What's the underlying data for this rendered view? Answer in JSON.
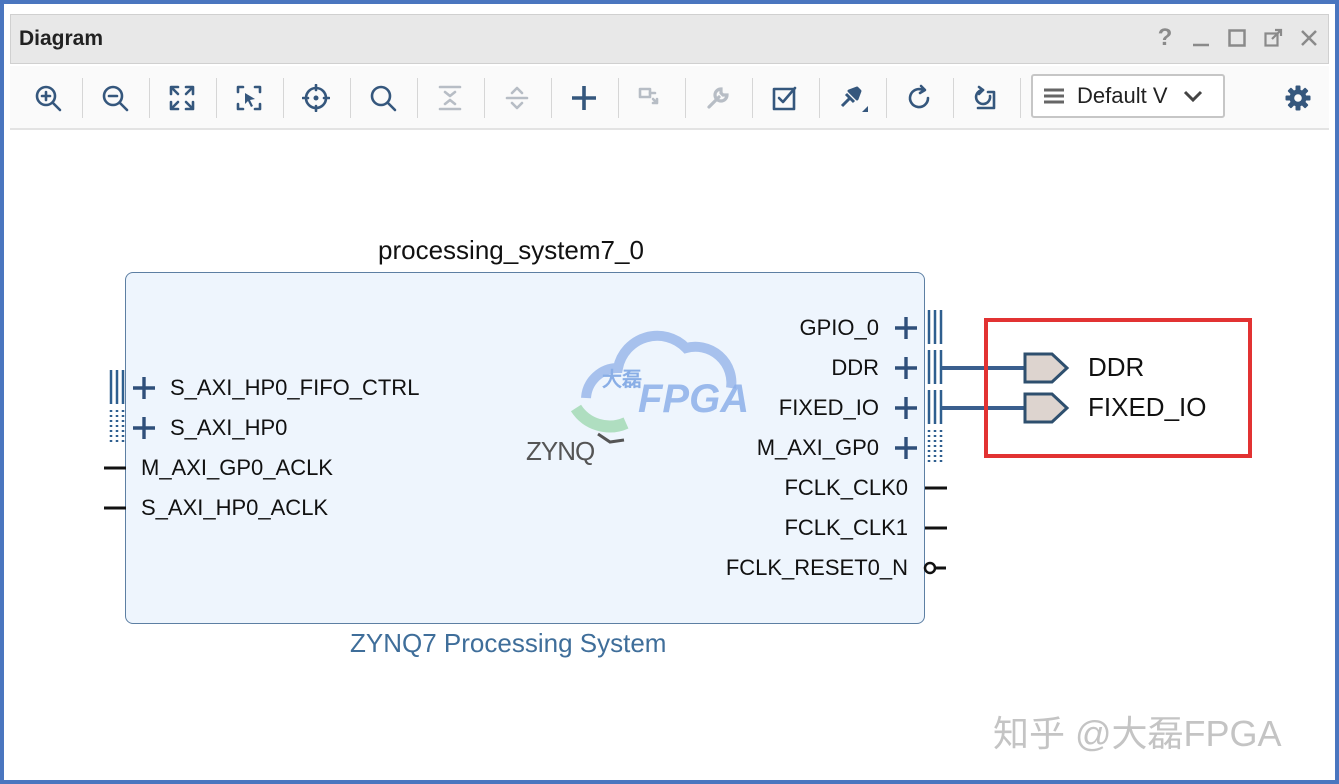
{
  "window": {
    "title": "Diagram",
    "accent": "#4a76bf"
  },
  "title_buttons": {
    "help": "?"
  },
  "toolbar": {
    "view_select_value": "Default V",
    "icons": [
      "zoom-in-icon",
      "zoom-out-icon",
      "zoom-fit-icon",
      "zoom-area-icon",
      "center-icon",
      "search-icon",
      "collapse-icon",
      "expand-icon",
      "add-ip-icon",
      "make-connection-icon",
      "wrench-icon",
      "validate-icon",
      "pin-icon",
      "refresh-icon",
      "regenerate-icon",
      "gear-icon"
    ]
  },
  "diagram": {
    "instance_name": "processing_system7_0",
    "block_title": "ZYNQ7 Processing System",
    "logo_text": "ZYNQ",
    "left_ports": [
      {
        "label": "S_AXI_HP0_FIFO_CTRL",
        "type": "bus"
      },
      {
        "label": "S_AXI_HP0",
        "type": "bus"
      },
      {
        "label": "M_AXI_GP0_ACLK",
        "type": "clock"
      },
      {
        "label": "S_AXI_HP0_ACLK",
        "type": "clock"
      }
    ],
    "right_ports": [
      {
        "label": "GPIO_0",
        "type": "bus"
      },
      {
        "label": "DDR",
        "type": "bus"
      },
      {
        "label": "FIXED_IO",
        "type": "bus"
      },
      {
        "label": "M_AXI_GP0",
        "type": "bus"
      },
      {
        "label": "FCLK_CLK0",
        "type": "clock"
      },
      {
        "label": "FCLK_CLK1",
        "type": "clock"
      },
      {
        "label": "FCLK_RESET0_N",
        "type": "reset"
      }
    ],
    "external_ports": [
      {
        "label": "DDR"
      },
      {
        "label": "FIXED_IO"
      }
    ],
    "highlight_color": "#e23232"
  },
  "watermark": {
    "center_text": "FPGA",
    "center_text_cn": "大磊",
    "corner_text": "知乎 @大磊FPGA"
  }
}
